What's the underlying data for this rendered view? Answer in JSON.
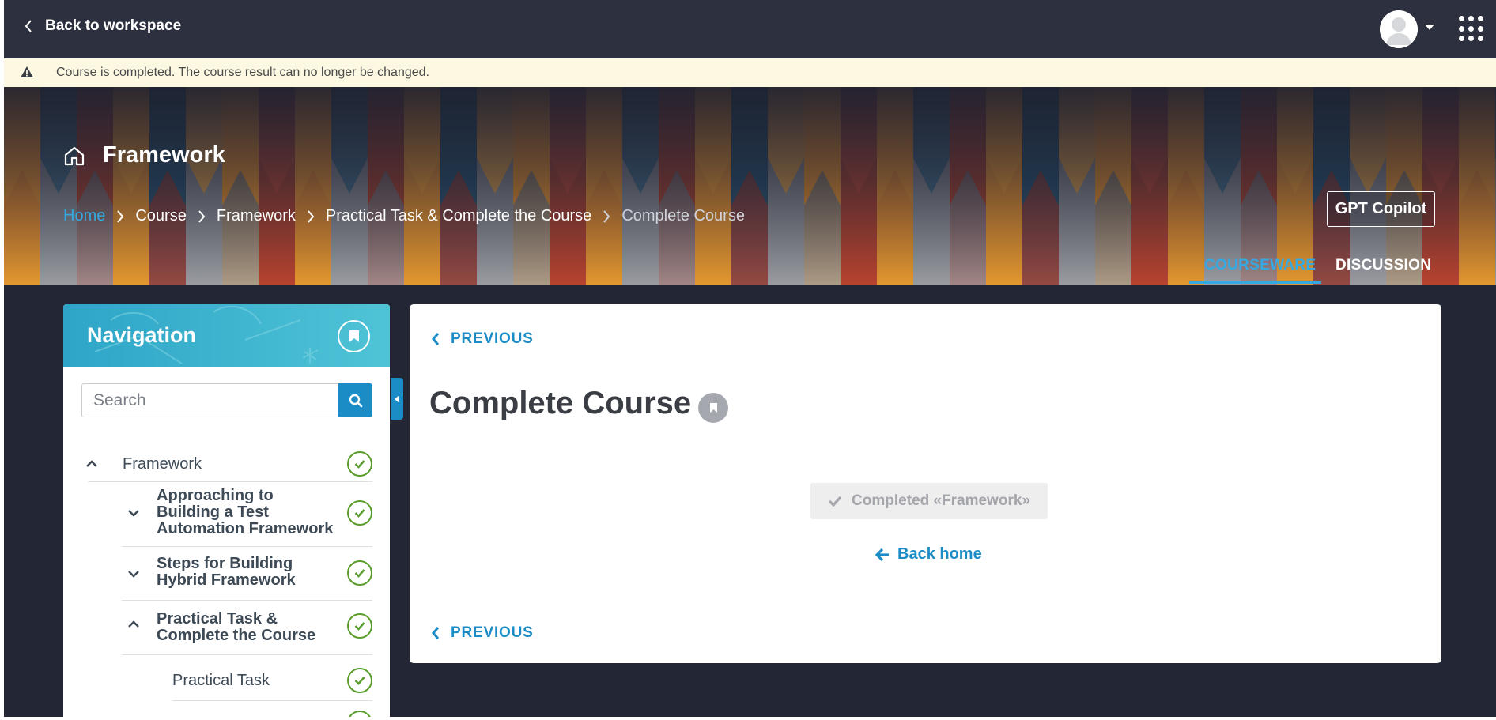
{
  "topbar": {
    "back_label": "Back to workspace"
  },
  "notice": {
    "text": "Course is completed. The course result can no longer be changed."
  },
  "banner": {
    "title": "Framework",
    "breadcrumbs": [
      "Home",
      "Course",
      "Framework",
      "Practical Task & Complete the Course",
      "Complete Course"
    ],
    "gpt_button": "GPT Copilot",
    "tabs": [
      "COURSEWARE",
      "DISCUSSION"
    ],
    "active_tab": "COURSEWARE"
  },
  "navigation": {
    "title": "Navigation",
    "search_placeholder": "Search",
    "items": [
      {
        "label": "Framework",
        "expanded": true,
        "completed": true
      },
      {
        "label": "Approaching to Building a Test Automation Framework",
        "expanded": false,
        "completed": true
      },
      {
        "label": "Steps for Building Hybrid Framework",
        "expanded": false,
        "completed": true
      },
      {
        "label": "Practical Task & Complete the Course",
        "expanded": true,
        "completed": true
      },
      {
        "label": "Practical Task",
        "completed": true
      }
    ]
  },
  "content": {
    "previous_label": "PREVIOUS",
    "title": "Complete Course",
    "completed_button": "Completed «Framework»",
    "back_home": "Back home"
  },
  "colors": {
    "accent": "#1b8cc5",
    "link": "#36a9e1",
    "success": "#5a9d2c",
    "topbar": "#2d303e",
    "background": "#232735",
    "notice": "#fdf8e2"
  }
}
